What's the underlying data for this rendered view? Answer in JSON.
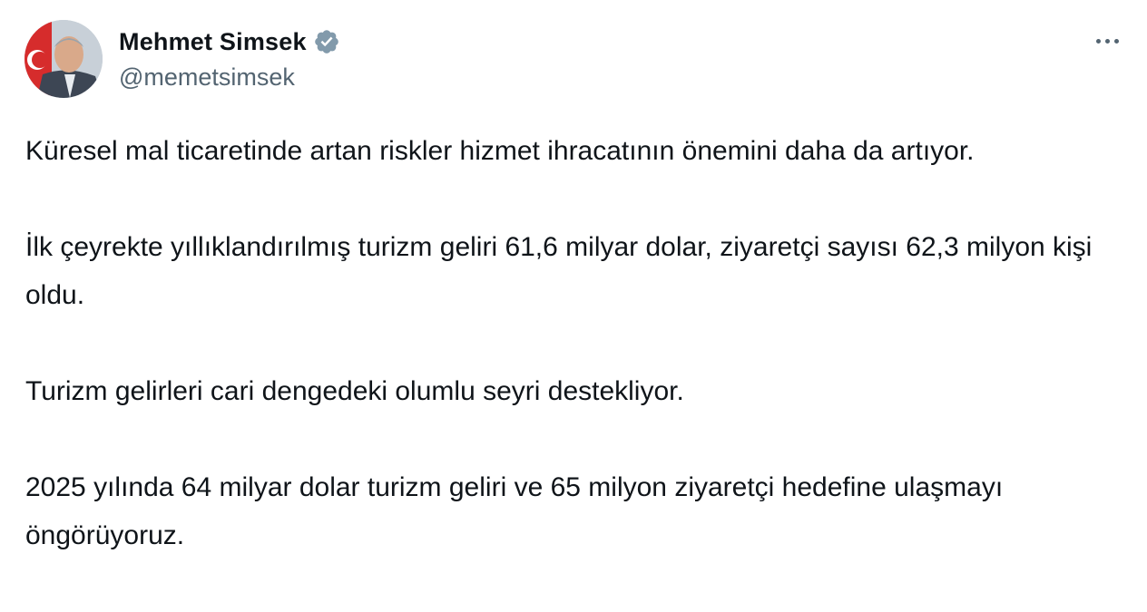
{
  "author": {
    "display_name": "Mehmet Simsek",
    "handle": "@memetsimsek",
    "verified": true,
    "verified_color": "#829aab"
  },
  "icons": {
    "avatar": "profile-photo",
    "verified": "verified-badge-icon",
    "more": "more-options-icon"
  },
  "tweet": {
    "paragraphs": [
      "Küresel mal ticaretinde artan riskler hizmet ihracatının önemini daha da artıyor.",
      "İlk çeyrekte yıllıklandırılmış turizm geliri 61,6 milyar dolar, ziyaretçi sayısı 62,3 milyon kişi oldu.",
      "Turizm gelirleri cari dengedeki olumlu seyri destekliyor.",
      "2025 yılında 64 milyar dolar turizm geliri ve 65 milyon ziyaretçi hedefine ulaşmayı öngörüyoruz."
    ]
  }
}
